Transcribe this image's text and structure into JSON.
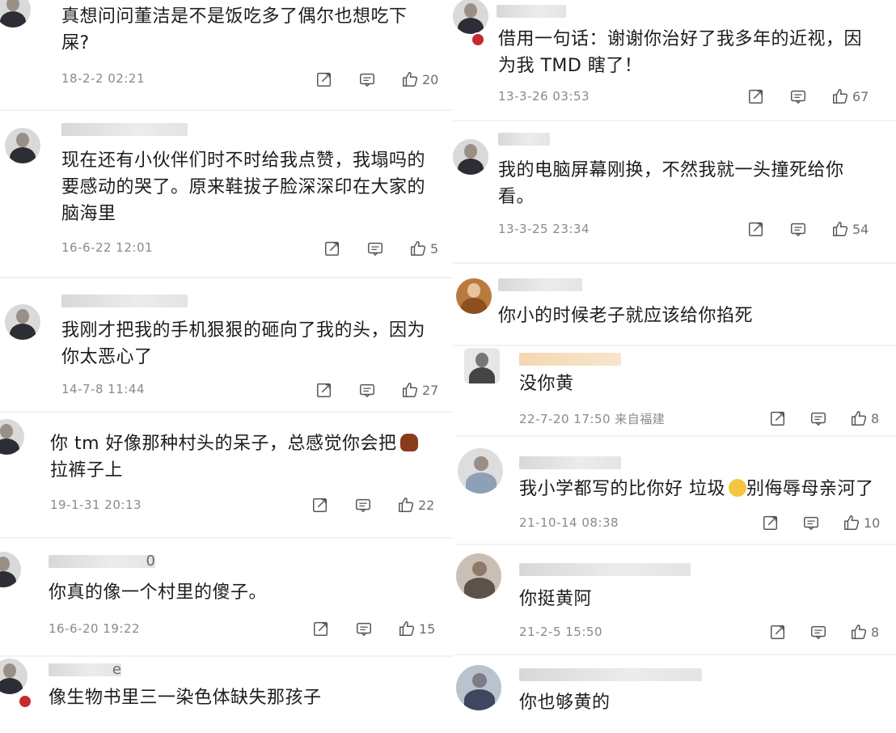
{
  "comments": [
    {
      "name": "",
      "text": [
        "真想问问董洁是不是饭吃多了偶尔也想吃下",
        "屎?"
      ],
      "date": "18-2-2 02:21",
      "likes": "20"
    },
    {
      "name": "",
      "text": [
        "现在还有小伙伴们时不时给我点赞，我塌吗的",
        "要感动的哭了。原来鞋拔子脸深深印在大家的",
        "脑海里"
      ],
      "date": "16-6-22 12:01",
      "likes": "5"
    },
    {
      "name": "",
      "text": [
        "我刚才把我的手机狠狠的砸向了我的头，因为",
        "你太恶心了"
      ],
      "date": "14-7-8 11:44",
      "likes": "27"
    },
    {
      "name": "",
      "text": [
        "你 tm 好像那种村头的呆子，总感觉你会把",
        "拉裤子上"
      ],
      "date": "19-1-31 20:13",
      "likes": "22"
    },
    {
      "name": "0",
      "text": [
        "你真的像一个村里的傻子。"
      ],
      "date": "16-6-20 19:22",
      "likes": "15"
    },
    {
      "name": "e",
      "text": [
        "像生物书里三一染色体缺失那孩子"
      ],
      "date": "",
      "likes": ""
    },
    {
      "name": "",
      "text": [
        "借用一句话：谢谢你治好了我多年的近视，因",
        "为我 TMD 瞎了！"
      ],
      "date": "13-3-26 03:53",
      "likes": "67"
    },
    {
      "name": "",
      "text": [
        "我的电脑屏幕刚换，不然我就一头撞死给你",
        "看。"
      ],
      "date": "13-3-25 23:34",
      "likes": "54"
    },
    {
      "name": "",
      "text": [
        "你小的时候老子就应该给你掐死"
      ],
      "date": "",
      "likes": ""
    },
    {
      "name": "",
      "text": [
        "没你黄"
      ],
      "date": "22-7-20 17:50 来自福建",
      "likes": "8"
    },
    {
      "name": "",
      "text": [
        "我小学都写的比你好 垃圾",
        "别侮辱母亲河了"
      ],
      "date": "21-10-14 08:38",
      "likes": "10"
    },
    {
      "name": "",
      "text": [
        "你挺黄阿"
      ],
      "date": "21-2-5 15:50",
      "likes": "8"
    },
    {
      "name": "",
      "text": [
        "你也够黄的"
      ],
      "date": "",
      "likes": ""
    }
  ],
  "icons": {
    "share": "share-icon",
    "reply": "reply-icon",
    "like": "thumbs-up-icon",
    "poop": "poop-emoji",
    "sad": "crying-emoji"
  },
  "colors": {
    "badge": "#c8292e",
    "meta": "#8a8a8a",
    "text": "#1c1c1c"
  }
}
